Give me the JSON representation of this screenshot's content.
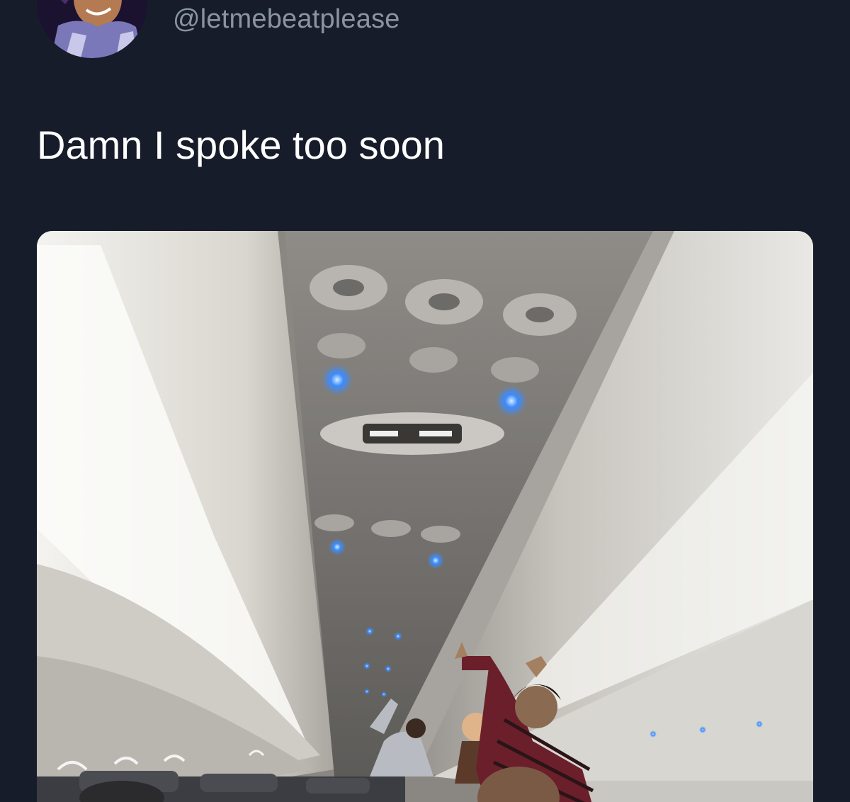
{
  "tweet": {
    "handle": "@letmebeatplease",
    "text": "Damn I spoke too soon",
    "avatar_icon": "cartoon-character-avatar-icon",
    "media_description_icon": "airplane-cabin-photo"
  },
  "colors": {
    "background": "#161c2a",
    "handle_text": "#8a94a3",
    "tweet_text": "#ffffff",
    "cabin_light": "#3b8cff"
  }
}
